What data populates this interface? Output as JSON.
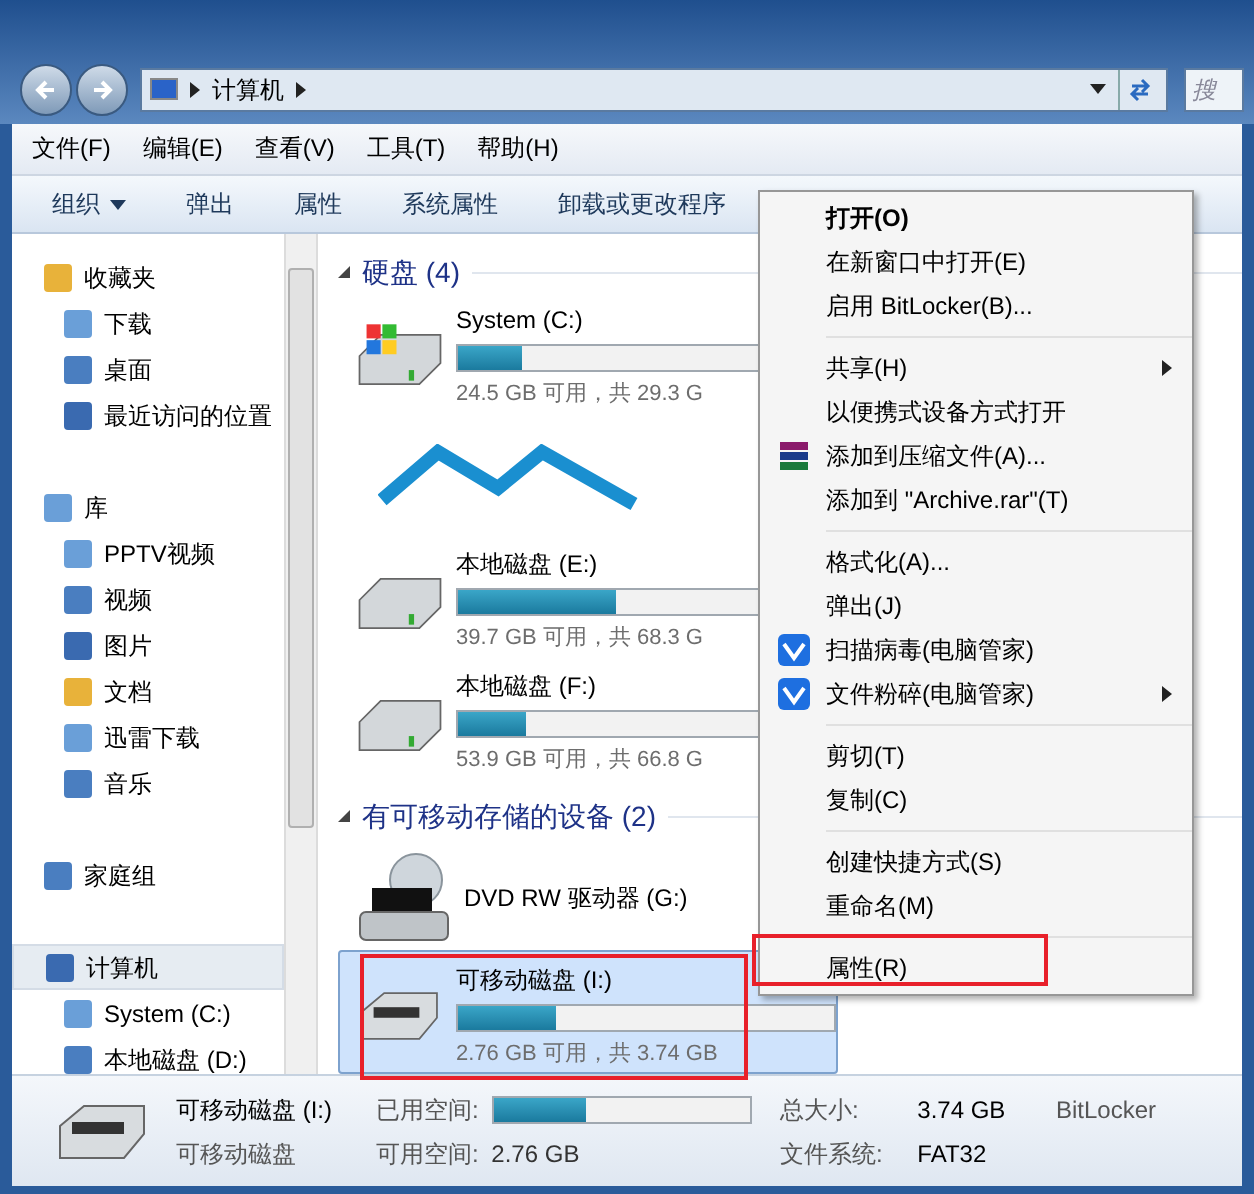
{
  "address_bar": {
    "crumbs": [
      "计算机"
    ]
  },
  "search": {
    "placeholder": "搜"
  },
  "menu_bar": [
    "文件(F)",
    "编辑(E)",
    "查看(V)",
    "工具(T)",
    "帮助(H)"
  ],
  "toolbar": [
    {
      "label": "组织",
      "dropdown": true
    },
    {
      "label": "弹出",
      "dropdown": false
    },
    {
      "label": "属性",
      "dropdown": false
    },
    {
      "label": "系统属性",
      "dropdown": false
    },
    {
      "label": "卸载或更改程序",
      "dropdown": false
    }
  ],
  "sidebar": [
    {
      "label": "收藏夹",
      "selected": false,
      "children": [
        {
          "label": "下载",
          "selected": false
        },
        {
          "label": "桌面",
          "selected": false
        },
        {
          "label": "最近访问的位置",
          "selected": false
        }
      ]
    },
    {
      "label": "库",
      "selected": false,
      "children": [
        {
          "label": "PPTV视频",
          "selected": false
        },
        {
          "label": "视频",
          "selected": false
        },
        {
          "label": "图片",
          "selected": false
        },
        {
          "label": "文档",
          "selected": false
        },
        {
          "label": "迅雷下载",
          "selected": false
        },
        {
          "label": "音乐",
          "selected": false
        }
      ]
    },
    {
      "label": "家庭组",
      "selected": false
    },
    {
      "label": "计算机",
      "selected": true,
      "children": [
        {
          "label": "System (C:)",
          "selected": false
        },
        {
          "label": "本地磁盘 (D:)",
          "selected": false
        }
      ]
    }
  ],
  "groups": [
    {
      "title": "硬盘 (4)",
      "items": [
        {
          "kind": "system",
          "name": "System (C:)",
          "level": 0.17,
          "reading": "24.5 GB 可用，共 29.3 G",
          "selected": false
        },
        {
          "kind": "obscured"
        },
        {
          "kind": "disk",
          "name": "本地磁盘 (E:)",
          "level": 0.42,
          "reading": "39.7 GB 可用，共 68.3 G",
          "selected": false
        },
        {
          "kind": "disk",
          "name": "本地磁盘 (F:)",
          "level": 0.18,
          "reading": "53.9 GB 可用，共 66.8 G",
          "selected": false
        }
      ]
    },
    {
      "title": "有可移动存储的设备 (2)",
      "items": [
        {
          "kind": "dvd",
          "name": "DVD RW 驱动器 (G:)",
          "selected": false
        },
        {
          "kind": "usb",
          "name": "可移动磁盘 (I:)",
          "level": 0.26,
          "reading": "2.76 GB 可用，共 3.74 GB",
          "selected": true
        }
      ]
    }
  ],
  "context_menu": [
    [
      {
        "label": "打开(O)",
        "kind": "default",
        "submenu": false
      },
      {
        "label": "在新窗口中打开(E)",
        "kind": "plain",
        "submenu": false
      },
      {
        "label": "启用 BitLocker(B)...",
        "kind": "plain",
        "submenu": false
      }
    ],
    [
      {
        "label": "共享(H)",
        "kind": "plain",
        "submenu": true
      },
      {
        "label": "以便携式设备方式打开",
        "kind": "plain",
        "submenu": false
      },
      {
        "label": "添加到压缩文件(A)...",
        "kind": "archive",
        "submenu": false
      },
      {
        "label": "添加到 \"Archive.rar\"(T)",
        "kind": "plain",
        "submenu": false
      }
    ],
    [
      {
        "label": "格式化(A)...",
        "kind": "plain",
        "submenu": false
      },
      {
        "label": "弹出(J)",
        "kind": "plain",
        "submenu": false
      },
      {
        "label": "扫描病毒(电脑管家)",
        "kind": "shield",
        "submenu": false
      },
      {
        "label": "文件粉碎(电脑管家)",
        "kind": "shield",
        "submenu": true
      }
    ],
    [
      {
        "label": "剪切(T)",
        "kind": "plain",
        "submenu": false
      },
      {
        "label": "复制(C)",
        "kind": "plain",
        "submenu": false
      }
    ],
    [
      {
        "label": "创建快捷方式(S)",
        "kind": "plain",
        "submenu": false
      },
      {
        "label": "重命名(M)",
        "kind": "plain",
        "submenu": false
      }
    ],
    [
      {
        "label": "属性(R)",
        "kind": "plain",
        "submenu": false
      }
    ]
  ],
  "details": {
    "name": "可移动磁盘 (I:)",
    "type": "可移动磁盘",
    "used_label": "已用空间:",
    "level": 0.36,
    "free_label": "可用空间:",
    "free": "2.76 GB",
    "total_label": "总大小:",
    "total": "3.74 GB",
    "fs_label": "文件系统:",
    "fs": "FAT32",
    "bitlocker": "BitLocker"
  }
}
